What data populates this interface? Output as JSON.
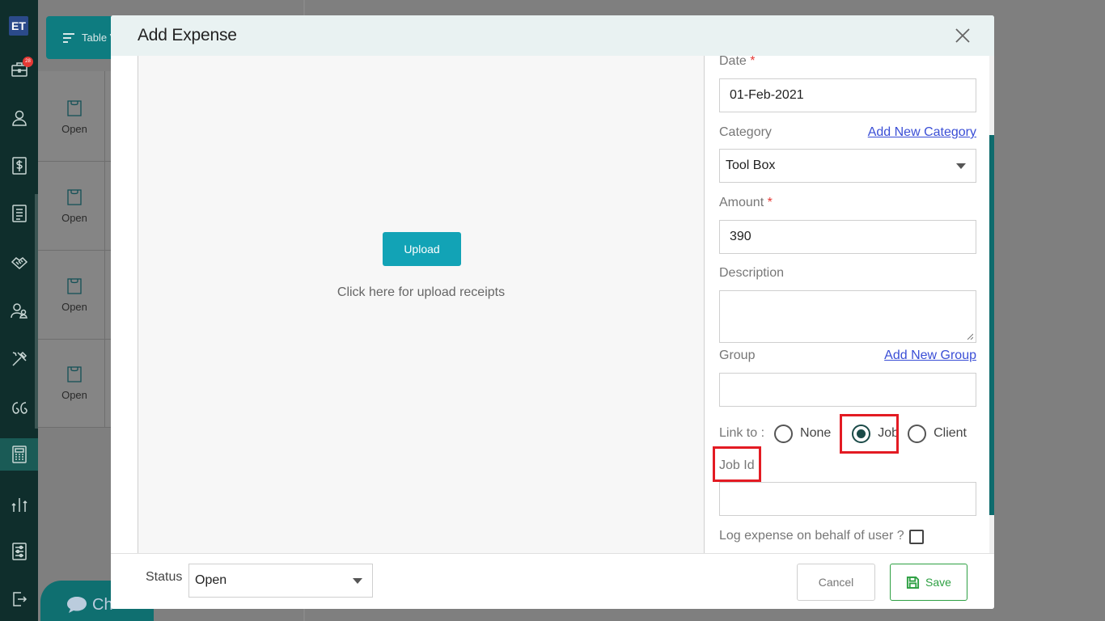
{
  "sidebar": {
    "logo_text": "ET",
    "badge_count": "28",
    "items": [
      {
        "icon": "briefcase-icon"
      },
      {
        "icon": "user-icon"
      },
      {
        "icon": "dollar-icon"
      },
      {
        "icon": "list-icon"
      },
      {
        "icon": "handshake-icon"
      },
      {
        "icon": "users-icon"
      },
      {
        "icon": "tools-icon"
      },
      {
        "icon": "quote-icon"
      },
      {
        "icon": "calculator-icon"
      },
      {
        "icon": "reports-icon"
      },
      {
        "icon": "settings-sliders-icon"
      },
      {
        "icon": "logout-icon"
      }
    ]
  },
  "background": {
    "table_view_label": "Table V",
    "rows": [
      "Open",
      "Open",
      "Open",
      "Open"
    ],
    "chat_label": "Ch"
  },
  "modal": {
    "title": "Add Expense",
    "upload_button": "Upload",
    "upload_hint": "Click here for upload receipts",
    "form": {
      "date_label": "Date",
      "date_value": "01-Feb-2021",
      "category_label": "Category",
      "add_category_link": "Add New Category",
      "category_value": "Tool Box",
      "amount_label": "Amount",
      "amount_value": "390",
      "description_label": "Description",
      "description_value": "",
      "group_label": "Group",
      "add_group_link": "Add New Group",
      "group_value": "",
      "link_to_label": "Link to :",
      "link_options": [
        "None",
        "Job",
        "Client"
      ],
      "link_selected": "Job",
      "job_id_label": "Job Id",
      "job_id_value": "",
      "behalf_label": "Log expense on behalf of user ?",
      "required_mark": "*"
    },
    "footer": {
      "status_label": "Status",
      "status_value": "Open",
      "cancel_label": "Cancel",
      "save_label": "Save"
    }
  },
  "colors": {
    "accent": "#12a3b6",
    "sidebar_bg": "#0f2e2c",
    "highlight": "#e31b23",
    "save_green": "#2ea043"
  }
}
